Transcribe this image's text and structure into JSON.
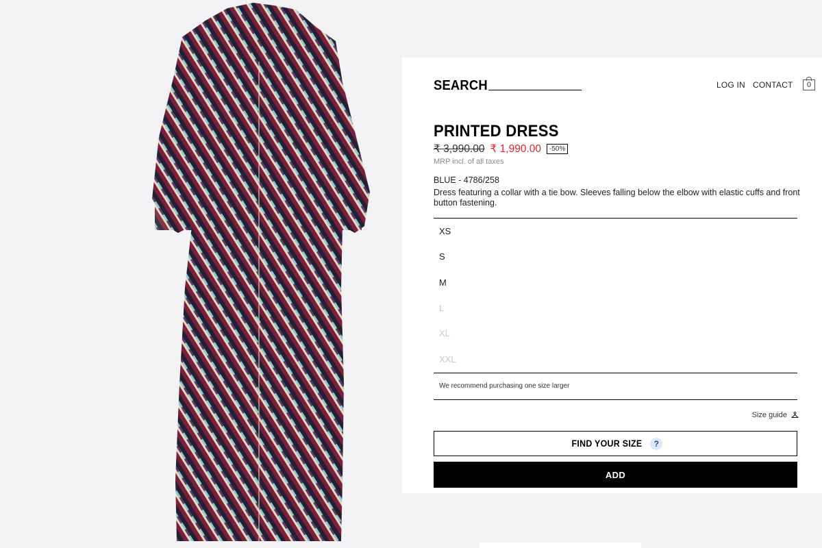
{
  "header": {
    "search_label": "SEARCH",
    "login_label": "LOG IN",
    "contact_label": "CONTACT",
    "cart_count": "0"
  },
  "product": {
    "title": "PRINTED DRESS",
    "price_original": "₹ 3,990.00",
    "price_sale": "₹ 1,990.00",
    "discount": "-50%",
    "mrp_note": "MRP incl. of all taxes",
    "color_ref": "BLUE - 4786/258",
    "description": "Dress featuring a collar with a tie bow. Sleeves falling below the elbow with elastic cuffs and front button fastening.",
    "sale_color": "#e8212b"
  },
  "sizes": [
    {
      "label": "XS",
      "available": true
    },
    {
      "label": "S",
      "available": true
    },
    {
      "label": "M",
      "available": true
    },
    {
      "label": "L",
      "available": false
    },
    {
      "label": "XL",
      "available": false
    },
    {
      "label": "XXL",
      "available": false
    }
  ],
  "size_note": "We recommend purchasing one size larger",
  "size_guide_label": "Size guide",
  "find_size_label": "FIND YOUR SIZE",
  "help_glyph": "?",
  "add_label": "ADD",
  "icons": {
    "cart": "shopping-bag-icon",
    "size_guide": "hanger-icon",
    "help": "help-icon"
  }
}
